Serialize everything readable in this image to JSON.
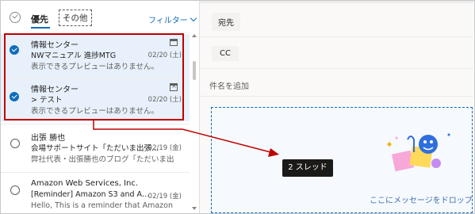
{
  "list": {
    "tab_focused": "優先",
    "tab_other": "その他",
    "filter_label": "フィルター",
    "messages": [
      {
        "sender": "情報センター",
        "subject": "NWマニュアル 進捗MTG",
        "preview": "表示できるプレビューはありません。",
        "date": "02/20 (土)",
        "icon": "calendar-icon",
        "selected": true
      },
      {
        "sender": "情報センター",
        "subject": "> テスト",
        "preview": "表示できるプレビューはありません。",
        "date": "02/20 (土)",
        "icon": "calendar-cancel-icon",
        "selected": true
      },
      {
        "sender": "出張 勝也",
        "subject": "会場サポートサイト「ただいま出張…",
        "preview": "弊社代表・出張勝也のブログ「ただいま出張…",
        "date": "02/19 (金)",
        "selected": false
      },
      {
        "sender": "Amazon Web Services, Inc.",
        "subject": "[Reminder] Amazon S3 and A…",
        "preview": "Hello, This is a reminder that Amazon Si…",
        "date": "02/19 (金)",
        "selected": false
      }
    ]
  },
  "compose": {
    "to_label": "宛先",
    "cc_label": "CC",
    "subject_placeholder": "件名を追加",
    "drop_hint": "ここにメッセージをドロップ"
  },
  "tooltip": "2 スレッド",
  "colors": {
    "accent": "#0f6cbd",
    "highlight": "#c00000",
    "selected_bg": "#e8f1fb"
  }
}
